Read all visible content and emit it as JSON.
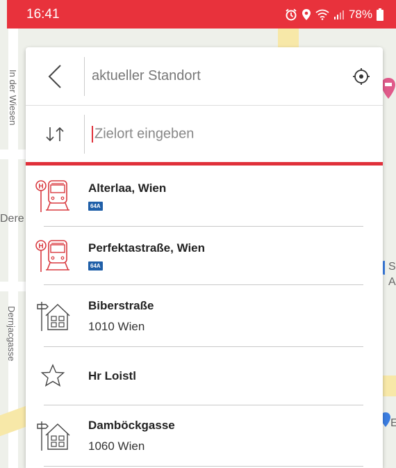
{
  "status_bar": {
    "time": "16:41",
    "battery": "78%",
    "icons": [
      "alarm-icon",
      "location-icon",
      "wifi-icon",
      "signal-icon",
      "battery-icon"
    ]
  },
  "map": {
    "labels": [
      "In der Wiesen",
      "Dere",
      "Dernjacgasse",
      "S",
      "A",
      "E"
    ]
  },
  "search": {
    "origin_value": "aktueller Standort",
    "destination_placeholder": "Zielort eingeben"
  },
  "results": [
    {
      "type": "stop",
      "icon": "tram-stop-icon",
      "title": "Alterlaa, Wien",
      "badge": "64A"
    },
    {
      "type": "stop",
      "icon": "tram-stop-icon",
      "title": "Perfektastraße, Wien",
      "badge": "64A"
    },
    {
      "type": "address",
      "icon": "address-house-icon",
      "title": "Biberstraße",
      "subtitle": "1010 Wien"
    },
    {
      "type": "favorite",
      "icon": "star-icon",
      "title": "Hr Loistl"
    },
    {
      "type": "address",
      "icon": "address-house-icon",
      "title": "Damböckgasse",
      "subtitle": "1060 Wien"
    }
  ],
  "colors": {
    "accent": "#e0303a",
    "status_bar": "#e8323c",
    "badge": "#1f5fa8"
  }
}
